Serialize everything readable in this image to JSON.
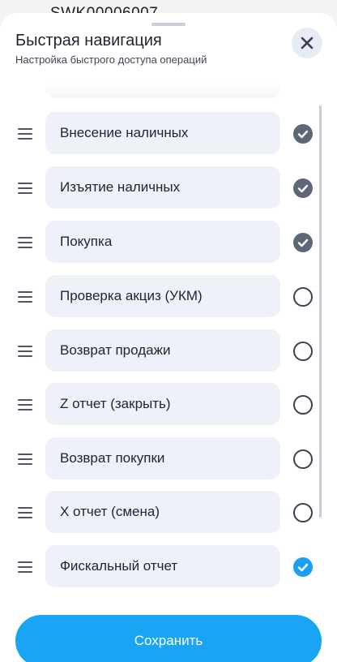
{
  "background": {
    "partial_text": "SWK00006007"
  },
  "sheet": {
    "title": "Быстрая навигация",
    "subtitle": "Настройка быстрого доступа операций",
    "close_icon": "close-icon"
  },
  "items": [
    {
      "label": "",
      "state": "partial"
    },
    {
      "label": "Внесение наличных",
      "state": "checked-gray"
    },
    {
      "label": "Изъятие наличных",
      "state": "checked-gray"
    },
    {
      "label": "Покупка",
      "state": "checked-gray"
    },
    {
      "label": "Проверка акциз (УКМ)",
      "state": "unchecked"
    },
    {
      "label": "Возврат продажи",
      "state": "unchecked"
    },
    {
      "label": "Z отчет (закрыть)",
      "state": "unchecked"
    },
    {
      "label": "Возврат покупки",
      "state": "unchecked"
    },
    {
      "label": "X отчет (смена)",
      "state": "unchecked"
    },
    {
      "label": "Фискальный отчет",
      "state": "checked-blue"
    }
  ],
  "footer": {
    "save_label": "Сохранить"
  },
  "colors": {
    "accent": "#1aa4f4",
    "checked_gray": "#5f6678",
    "pill_bg": "#eef1f7"
  }
}
